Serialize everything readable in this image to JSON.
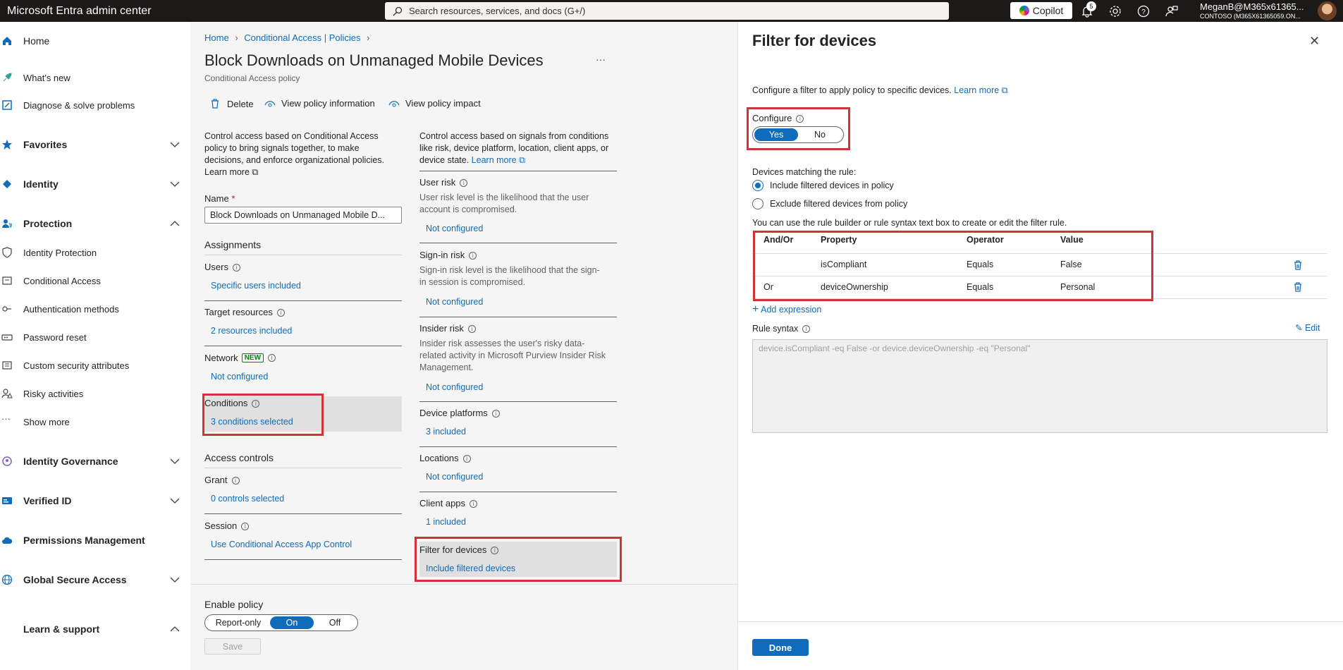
{
  "topbar": {
    "app_title": "Microsoft Entra admin center",
    "search_placeholder": "Search resources, services, and docs (G+/)",
    "copilot_label": "Copilot",
    "notification_count": "5",
    "account_name": "MeganB@M365x61365...",
    "account_org": "CONTOSO (M365X61365059.ON..."
  },
  "nav": {
    "home": "Home",
    "whats_new": "What's new",
    "diagnose": "Diagnose & solve problems",
    "favorites": "Favorites",
    "identity": "Identity",
    "protection": "Protection",
    "identity_protection": "Identity Protection",
    "conditional_access": "Conditional Access",
    "authentication_methods": "Authentication methods",
    "password_reset": "Password reset",
    "custom_security_attributes": "Custom security attributes",
    "risky_activities": "Risky activities",
    "show_more": "Show more",
    "identity_governance": "Identity Governance",
    "verified_id": "Verified ID",
    "permissions_management": "Permissions Management",
    "global_secure_access": "Global Secure Access",
    "learn_support": "Learn & support",
    "collapse": "«"
  },
  "breadcrumb": {
    "home": "Home",
    "ca_policies": "Conditional Access | Policies"
  },
  "policy": {
    "title": "Block Downloads on Unmanaged Mobile Devices",
    "more": "···",
    "subtitle": "Conditional Access policy"
  },
  "toolbar": {
    "delete": "Delete",
    "view_info": "View policy information",
    "view_impact": "View policy impact"
  },
  "left_col": {
    "desc_line1": "Control access based on Conditional Access",
    "desc_line2": "policy to bring signals together, to make",
    "desc_line3": "decisions, and enforce organizational policies.",
    "learn_more": "Learn more",
    "name_label": "Name",
    "name_required": "*",
    "name_value": "Block Downloads on Unmanaged Mobile D...",
    "assignments": "Assignments",
    "users_label": "Users",
    "users_value": "Specific users included",
    "target_label": "Target resources",
    "target_value": "2 resources included",
    "network_label": "Network",
    "network_badge": "NEW",
    "network_value": "Not configured",
    "conditions_label": "Conditions",
    "conditions_value": "3 conditions selected",
    "access_controls": "Access controls",
    "grant_label": "Grant",
    "grant_value": "0 controls selected",
    "session_label": "Session",
    "session_value": "Use Conditional Access App Control"
  },
  "right_col": {
    "desc_line1": "Control access based on signals from conditions",
    "desc_line2": "like risk, device platform, location, client apps, or",
    "desc_line3": "device state.",
    "learn_more": "Learn more",
    "user_risk_label": "User risk",
    "user_risk_desc1": "User risk level is the likelihood that the user",
    "user_risk_desc2": "account is compromised.",
    "user_risk_value": "Not configured",
    "signin_risk_label": "Sign-in risk",
    "signin_risk_desc1": "Sign-in risk level is the likelihood that the sign-",
    "signin_risk_desc2": "in session is compromised.",
    "signin_risk_value": "Not configured",
    "insider_risk_label": "Insider risk",
    "insider_risk_desc1": "Insider risk assesses the user's risky data-",
    "insider_risk_desc2": "related activity in Microsoft Purview Insider Risk",
    "insider_risk_desc3": "Management.",
    "insider_risk_value": "Not configured",
    "device_platforms_label": "Device platforms",
    "device_platforms_value": "3 included",
    "locations_label": "Locations",
    "locations_value": "Not configured",
    "client_apps_label": "Client apps",
    "client_apps_value": "1 included",
    "filter_devices_label": "Filter for devices",
    "filter_devices_value": "Include filtered devices"
  },
  "enable_policy": {
    "label": "Enable policy",
    "options": [
      "Report-only",
      "On",
      "Off"
    ],
    "selected": "On",
    "save": "Save"
  },
  "panel": {
    "title": "Filter for devices",
    "close": "✕",
    "desc": "Configure a filter to apply policy to specific devices.",
    "learn_more": "Learn more",
    "configure_label": "Configure",
    "configure_yes": "Yes",
    "configure_no": "No",
    "matching_label": "Devices matching the rule:",
    "include_option": "Include filtered devices in policy",
    "exclude_option": "Exclude filtered devices from policy",
    "builder_hint": "You can use the rule builder or rule syntax text box to create or edit the filter rule.",
    "table": {
      "headers": [
        "And/Or",
        "Property",
        "Operator",
        "Value"
      ],
      "rows": [
        {
          "andor": "",
          "property": "isCompliant",
          "operator": "Equals",
          "value": "False"
        },
        {
          "andor": "Or",
          "property": "deviceOwnership",
          "operator": "Equals",
          "value": "Personal"
        }
      ]
    },
    "add_expression": "Add expression",
    "rule_syntax_label": "Rule syntax",
    "edit": "Edit",
    "rule_syntax_value": "device.isCompliant -eq False -or device.deviceOwnership -eq \"Personal\"",
    "done": "Done"
  },
  "colors": {
    "accent": "#0f6cbd",
    "highlight": "#d13438",
    "topbar": "#1b1a19"
  }
}
